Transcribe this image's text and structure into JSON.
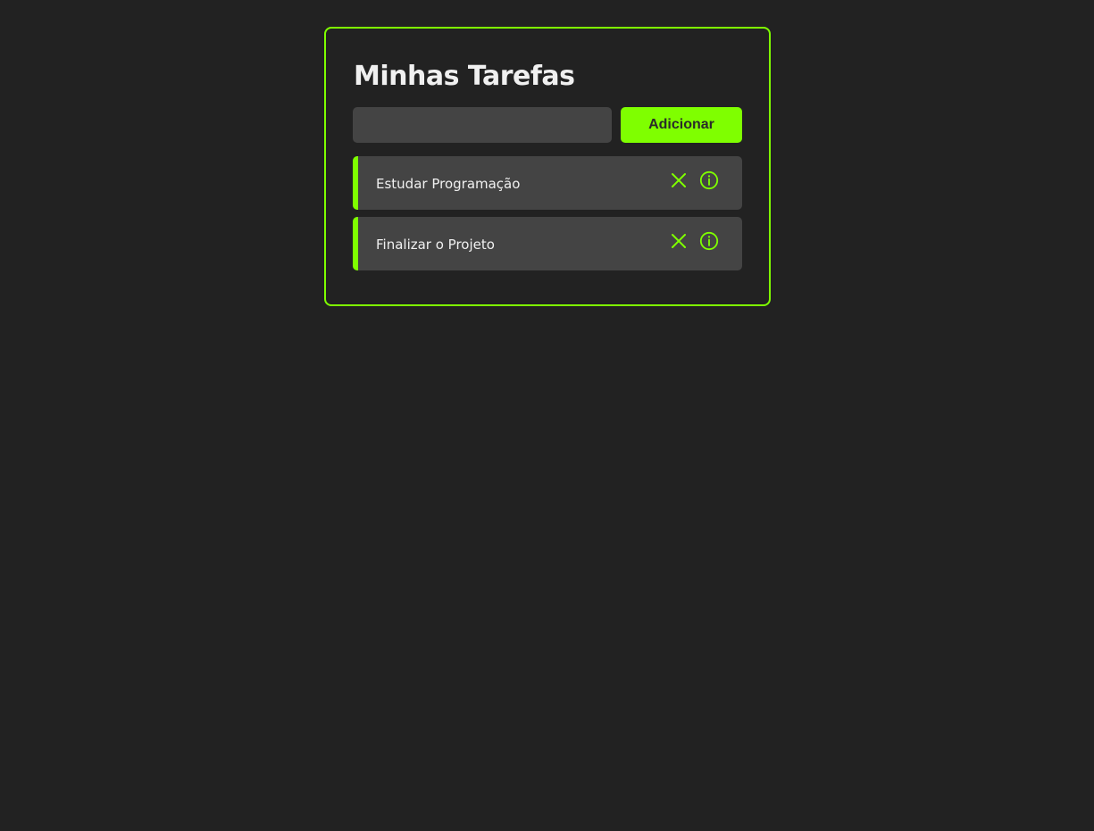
{
  "app": {
    "title": "Minhas Tarefas"
  },
  "form": {
    "input_value": "",
    "input_placeholder": "",
    "add_label": "Adicionar"
  },
  "tasks": [
    {
      "title": "Estudar Programação",
      "icons": [
        "close-icon",
        "info-icon"
      ]
    },
    {
      "title": "Finalizar o Projeto",
      "icons": [
        "close-icon",
        "info-icon"
      ]
    }
  ],
  "colors": {
    "accent": "#7fff00",
    "background": "#222222",
    "surface": "#444444",
    "text": "#f0f0f0"
  }
}
